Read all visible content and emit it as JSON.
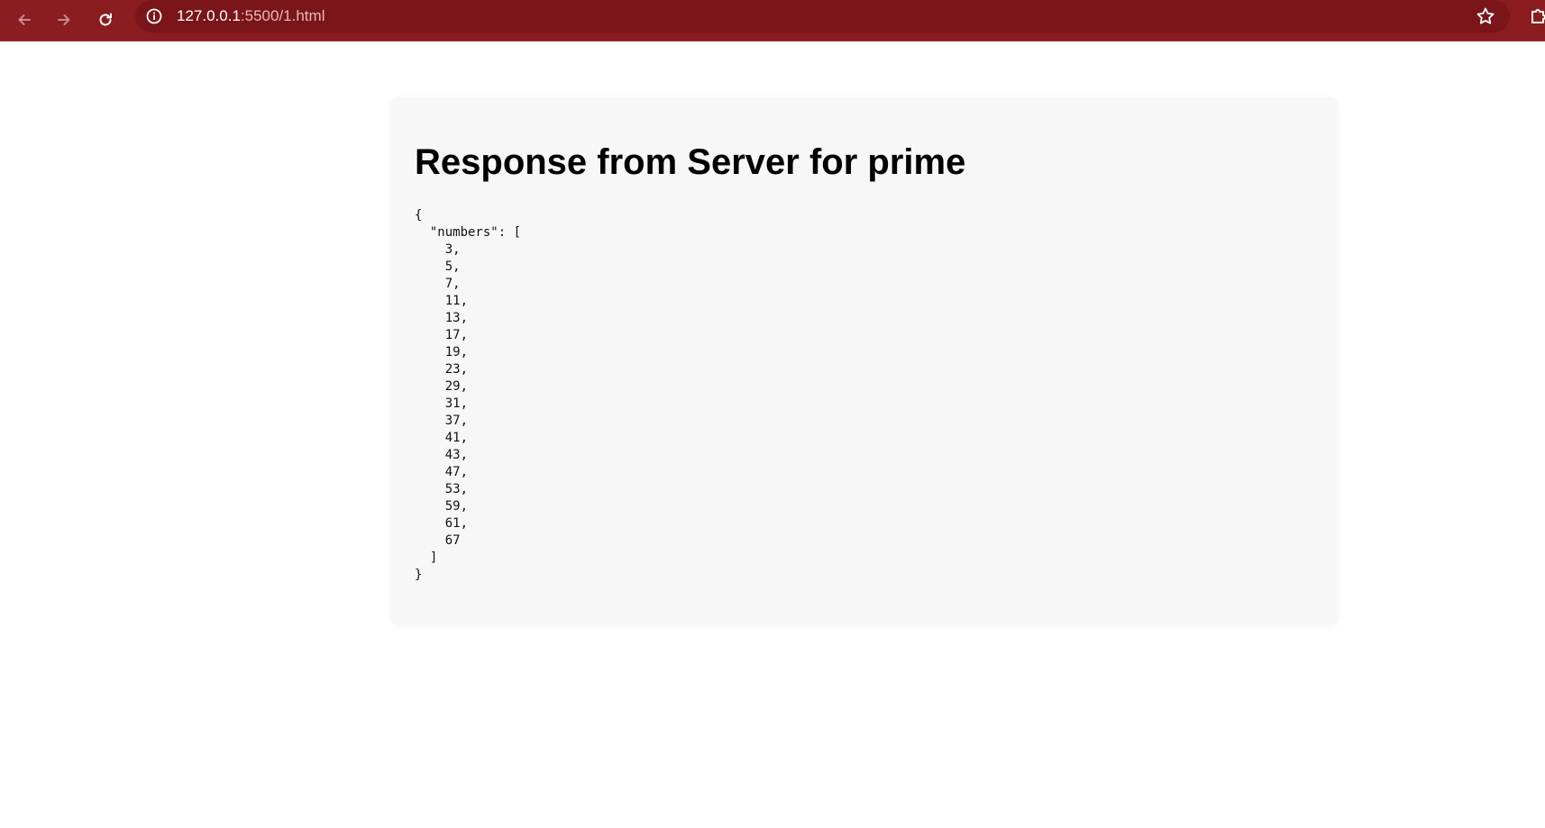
{
  "browser": {
    "url_host": "127.0.0.1",
    "url_path": ":5500/1.html",
    "icons": {
      "back": "arrow-left-icon",
      "forward": "arrow-right-icon",
      "reload": "reload-icon",
      "site_info": "info-icon",
      "bookmark": "star-icon",
      "extensions": "puzzle-icon"
    },
    "colors": {
      "toolbar": "#8b1c20",
      "omnibox": "#7a1519"
    }
  },
  "page": {
    "heading": "Response from Server for prime",
    "json_lines": [
      "{",
      "  \"numbers\": [",
      "    3,",
      "    5,",
      "    7,",
      "    11,",
      "    13,",
      "    17,",
      "    19,",
      "    23,",
      "    29,",
      "    31,",
      "    37,",
      "    41,",
      "    43,",
      "    47,",
      "    53,",
      "    59,",
      "    61,",
      "    67",
      "  ]",
      "}"
    ]
  }
}
